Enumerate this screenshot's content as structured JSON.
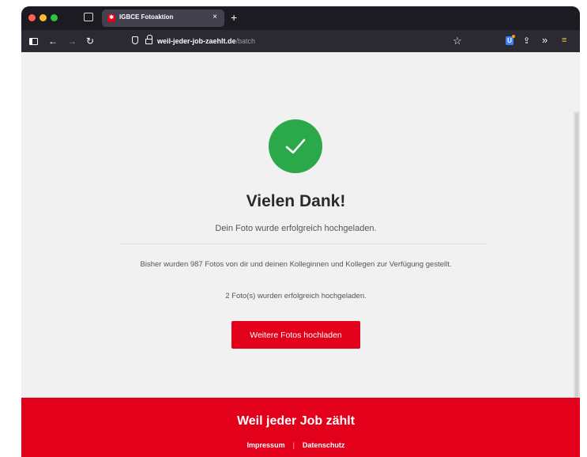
{
  "browser": {
    "tab_title": "IGBCE Fotoaktion",
    "tab_favicon_letter": "✱",
    "tab_close": "×",
    "new_tab": "+",
    "url_host": "weil-jeder-job-zaehlt.de",
    "url_path": "/batch",
    "icons": [
      "sidebar-icon",
      "back-icon",
      "forward-icon",
      "reload-icon",
      "shield-icon",
      "lock-icon",
      "bookmark-star-icon",
      "extension-icon",
      "share-icon",
      "overflow-chevrons-icon",
      "menu-icon"
    ]
  },
  "main": {
    "heading": "Vielen Dank!",
    "subline": "Dein Foto wurde erfolgreich hochgeladen.",
    "info": "Bisher wurden 987 Fotos von dir und deinen Kolleginnen und Kollegen zur Verfügung gestellt.",
    "uploaded_count": "2 Foto(s) wurden erfolgreich hochgeladen.",
    "button_label": "Weitere Fotos hochladen"
  },
  "footer": {
    "title": "Weil jeder Job zählt",
    "links": [
      "Impressum",
      "Datenschutz"
    ],
    "separator": "|"
  },
  "colors": {
    "accent": "#e2001a",
    "success": "#2ba84a",
    "toolbar": "#2b2a33",
    "tabbar": "#1c1b22"
  }
}
